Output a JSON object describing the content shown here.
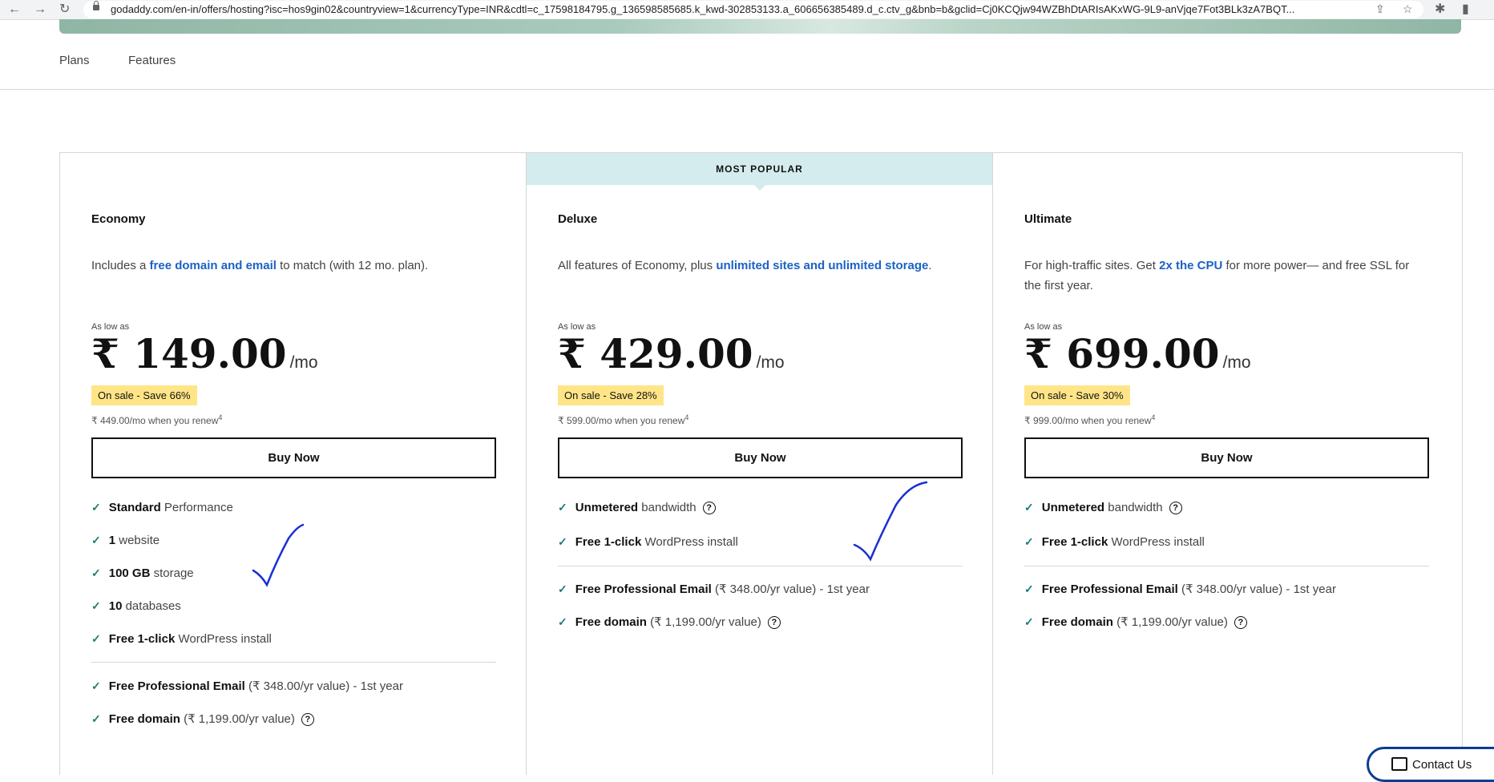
{
  "browser": {
    "url": "godaddy.com/en-in/offers/hosting?isc=hos9gin02&countryview=1&currencyType=INR&cdtl=c_17598184795.g_136598585685.k_kwd-302853133.a_606656385489.d_c.ctv_g&bnb=b&gclid=Cj0KCQjw94WZBhDtARIsAKxWG-9L9-anVjqe7Fot3BLk3zA7BQT..."
  },
  "subnav": {
    "plans": "Plans",
    "features": "Features"
  },
  "plans": [
    {
      "name": "Economy",
      "desc_pre": "Includes a ",
      "desc_link": "free domain and email",
      "desc_post": " to match (with 12 mo. plan).",
      "as_low_as": "As low as",
      "price": "₹ 149.00",
      "per": "/mo",
      "sale": "On sale - Save 66%",
      "renew": "₹ 449.00/mo when you renew",
      "renew_note": "4",
      "buy": "Buy Now",
      "features": [
        {
          "bold": "Standard",
          "rest": " Performance"
        },
        {
          "bold": "1",
          "rest": " website"
        },
        {
          "bold": "100 GB",
          "rest": " storage"
        },
        {
          "bold": "10",
          "rest": " databases"
        },
        {
          "bold": "Free 1-click",
          "rest": " WordPress install"
        }
      ],
      "extras": [
        {
          "bold": "Free Professional Email",
          "rest": " (₹ 348.00/yr value) - 1st year"
        },
        {
          "bold": "Free domain",
          "rest": " (₹ 1,199.00/yr value)"
        }
      ]
    },
    {
      "name": "Deluxe",
      "banner": "MOST POPULAR",
      "desc_pre": "All features of Economy, plus ",
      "desc_link": "unlimited sites and unlimited storage",
      "desc_post": ".",
      "as_low_as": "As low as",
      "price": "₹ 429.00",
      "per": "/mo",
      "sale": "On sale - Save 28%",
      "renew": "₹ 599.00/mo when you renew",
      "renew_note": "4",
      "buy": "Buy Now",
      "features": [
        {
          "bold": "Unmetered",
          "rest": " bandwidth"
        },
        {
          "bold": "Free 1-click",
          "rest": " WordPress install"
        }
      ],
      "extras": [
        {
          "bold": "Free Professional Email",
          "rest": " (₹ 348.00/yr value) - 1st year"
        },
        {
          "bold": "Free domain",
          "rest": " (₹ 1,199.00/yr value)"
        }
      ]
    },
    {
      "name": "Ultimate",
      "desc_pre": "For high-traffic sites. Get ",
      "desc_link": "2x the CPU",
      "desc_post": " for more power— and free SSL for the first year.",
      "as_low_as": "As low as",
      "price": "₹ 699.00",
      "per": "/mo",
      "sale": "On sale - Save 30%",
      "renew": "₹ 999.00/mo when you renew",
      "renew_note": "4",
      "buy": "Buy Now",
      "features": [
        {
          "bold": "Unmetered",
          "rest": " bandwidth"
        },
        {
          "bold": "Free 1-click",
          "rest": " WordPress install"
        }
      ],
      "extras": [
        {
          "bold": "Free Professional Email",
          "rest": " (₹ 348.00/yr value) - 1st year"
        },
        {
          "bold": "Free domain",
          "rest": " (₹ 1,199.00/yr value)"
        }
      ]
    }
  ],
  "contact": "Contact Us",
  "colors": {
    "link": "#1b62c4",
    "check": "#1b7d78",
    "sale_bg": "#ffe587",
    "banner_bg": "#d5ecee",
    "annotation": "#1a2fd6"
  }
}
